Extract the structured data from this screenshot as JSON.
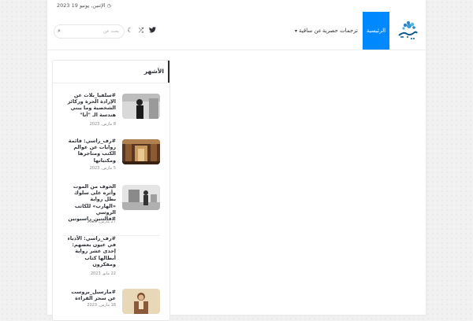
{
  "topbar": {
    "date": "الإثنين, يونيو 19 2023"
  },
  "header": {
    "logo_name": "site-logo",
    "nav": {
      "home": "الرئيسية",
      "exclusive": "ترجمات حصرية",
      "about": "عن ساقية"
    },
    "search_placeholder": "بحث عن",
    "accent": "#0088ff"
  },
  "sidebar": {
    "title": "الأشهر",
    "posts": [
      {
        "title": "#سلفيا_بلاث عن الإرادة الحرة وركائز الشخصية وما يبني هندسة الـ \"أنا\"",
        "meta": "8 مارس, 2023"
      },
      {
        "title": "#رف_راسي: قائمة روايات عن عوالم الكتب ومتاجرها ومكتباتها",
        "meta": "5 مارس, 2023"
      },
      {
        "title": "الخوف من الموت وأثره على سلوك بطل رواية «الهارب» للكاتب الروسي #فالنتين_راسبوتين",
        "meta": "27 مارس, 2023"
      },
      {
        "title": "#رف_راسي: الأدباء في عيون بعضهم: إحدى عشر رواية أبطالها كتاب ومفكرون",
        "meta": "22 مايو, 2023"
      },
      {
        "title": "#مارسيل_بروست عن سحر القراءة",
        "meta": "18 مارس, 2023"
      }
    ]
  }
}
